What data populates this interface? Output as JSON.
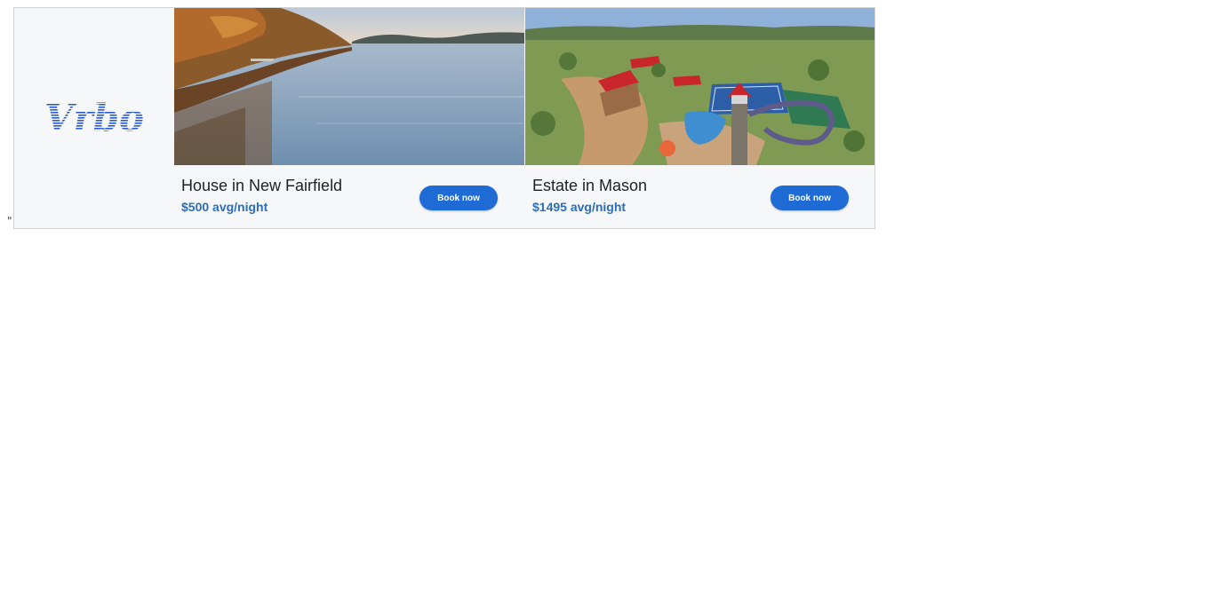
{
  "page": {
    "stray_mark": "\""
  },
  "ad": {
    "brand": "Vrbo",
    "brand_color": "#2b5bce",
    "button_color": "#1f6bd6",
    "price_color": "#2a6ebb",
    "choices_icon": "adchoices-icon",
    "close_icon": "close-icon",
    "listings": [
      {
        "title": "House in New Fairfield",
        "price": "$500 avg/night",
        "button_label": "Book now",
        "photo": "lake-shoreline-photo"
      },
      {
        "title": "Estate in Mason",
        "price": "$1495 avg/night",
        "button_label": "Book now",
        "photo": "ranch-estate-aerial-photo"
      }
    ]
  }
}
